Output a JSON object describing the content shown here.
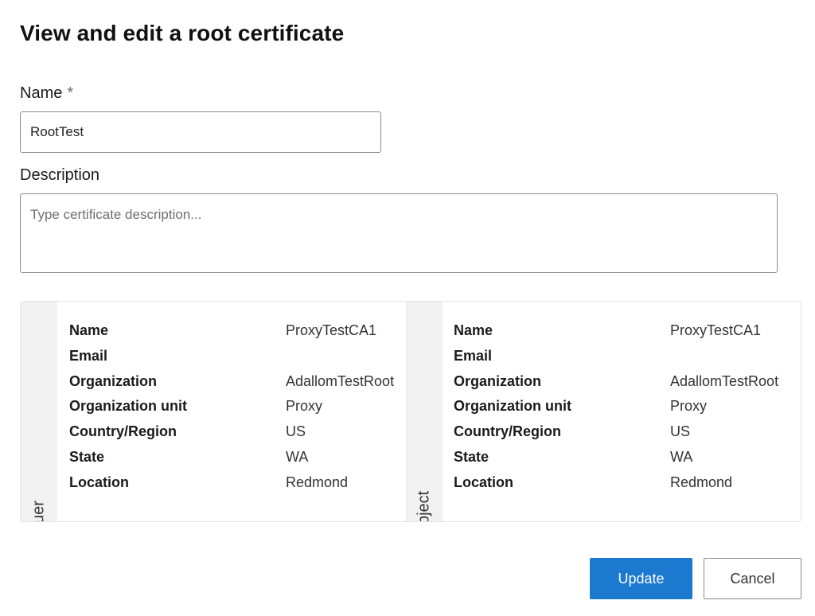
{
  "page": {
    "title": "View and edit a root certificate"
  },
  "form": {
    "name_label": "Name",
    "name_required_marker": "*",
    "name_value": "RootTest",
    "description_label": "Description",
    "description_placeholder": "Type certificate description...",
    "description_value": ""
  },
  "issuer": {
    "tab_label": "Issuer",
    "rows": [
      {
        "key": "Name",
        "value": "ProxyTestCA1"
      },
      {
        "key": "Email",
        "value": ""
      },
      {
        "key": "Organization",
        "value": "AdallomTestRoot"
      },
      {
        "key": "Organization unit",
        "value": "Proxy"
      },
      {
        "key": "Country/Region",
        "value": "US"
      },
      {
        "key": "State",
        "value": "WA"
      },
      {
        "key": "Location",
        "value": "Redmond"
      }
    ]
  },
  "subject": {
    "tab_label": "Subject",
    "rows": [
      {
        "key": "Name",
        "value": "ProxyTestCA1"
      },
      {
        "key": "Email",
        "value": ""
      },
      {
        "key": "Organization",
        "value": "AdallomTestRoot"
      },
      {
        "key": "Organization unit",
        "value": "Proxy"
      },
      {
        "key": "Country/Region",
        "value": "US"
      },
      {
        "key": "State",
        "value": "WA"
      },
      {
        "key": "Location",
        "value": "Redmond"
      }
    ]
  },
  "actions": {
    "update_label": "Update",
    "cancel_label": "Cancel"
  },
  "colors": {
    "primary_button": "#1c79d0",
    "side_tab_background": "#f1f1f1"
  }
}
